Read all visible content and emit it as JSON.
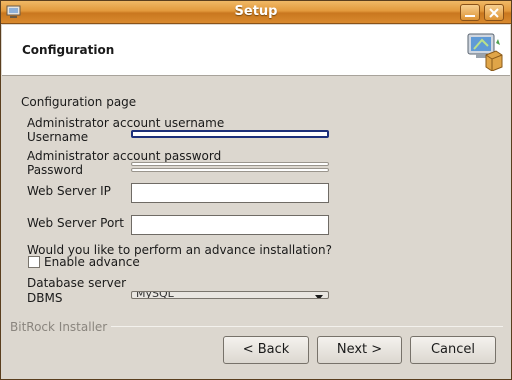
{
  "window": {
    "title": "Setup"
  },
  "header": {
    "title": "Configuration"
  },
  "page": {
    "heading": "Configuration page"
  },
  "form": {
    "admin_username_group": "Administrator account username",
    "username_label": "Username",
    "username_value": "",
    "admin_password_group": "Administrator account password",
    "password_label": "Password",
    "password_value": "",
    "webserver_ip_label": "Web Server IP",
    "webserver_ip_value": "",
    "webserver_port_label": "Web Server Port",
    "webserver_port_value": "",
    "advance_question": "Would you like to perform an advance installation?",
    "enable_advance_label": "Enable advance",
    "enable_advance_checked": false,
    "database_server_label": "Database server",
    "dbms_label": "DBMS",
    "dbms_value": "MySQL"
  },
  "footer": {
    "branding": "BitRock Installer"
  },
  "buttons": {
    "back": "< Back",
    "next": "Next >",
    "cancel": "Cancel"
  },
  "colors": {
    "titlebar": "#e39a3c",
    "focus_border": "#1c2f7a",
    "window_bg": "#dcd7cf"
  }
}
